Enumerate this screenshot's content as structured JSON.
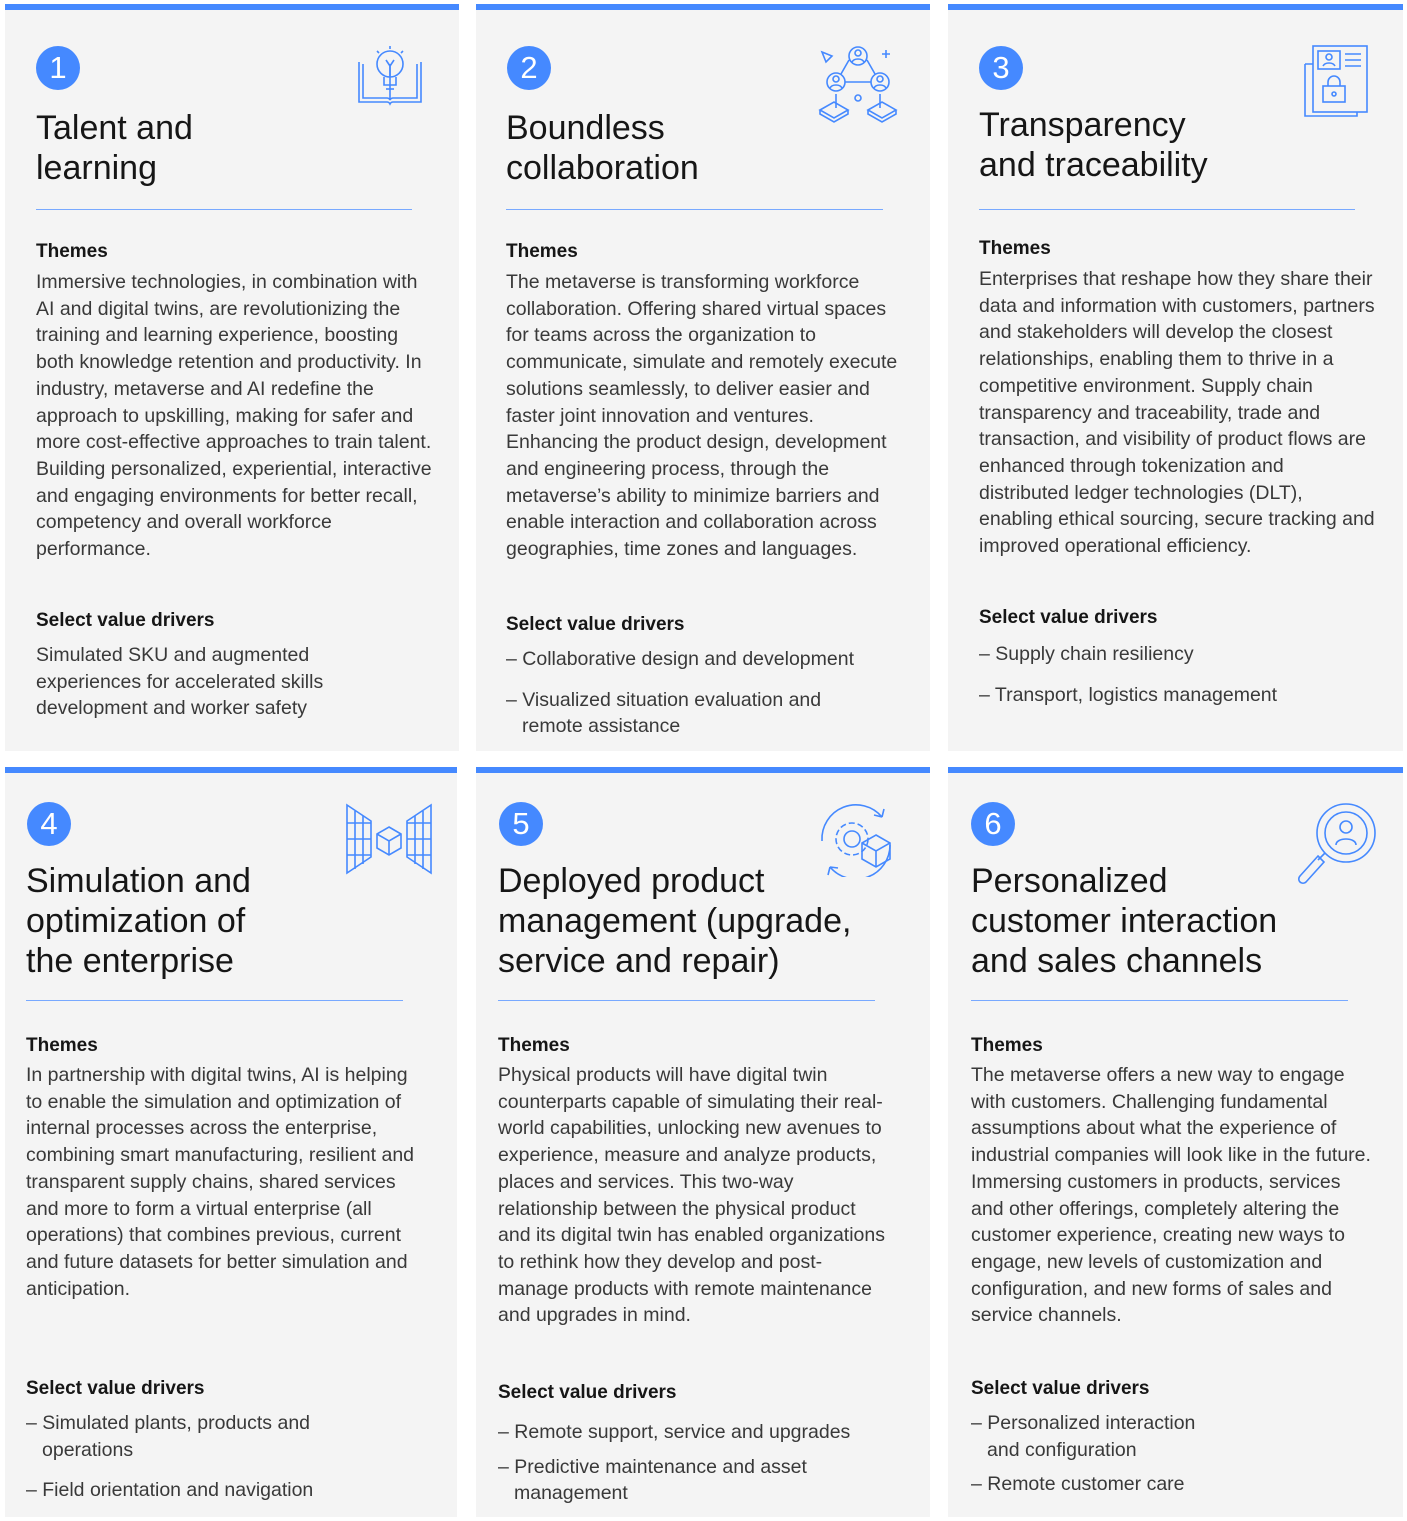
{
  "cards": [
    {
      "number": "1",
      "icon": "lightbulb-book-icon",
      "title": "Talent and\nlearning",
      "themes_label": "Themes",
      "themes_text": "Immersive technologies, in combination with AI and digital twins, are revolutionizing the training and learning experience, boosting both knowledge retention and productivity. In industry, metaverse and AI redefine the approach to upskilling, making for safer and more cost-effective approaches to train talent. Building personalized, experiential, interactive and engaging environments for better recall, competency and overall workforce performance.",
      "drivers_label": "Select value drivers",
      "drivers": [
        "Simulated SKU and augmented experiences for accelerated skills development and worker safety"
      ]
    },
    {
      "number": "2",
      "icon": "people-network-icon",
      "title": "Boundless\ncollaboration",
      "themes_label": "Themes",
      "themes_text": "The metaverse is transforming workforce collaboration. Offering shared virtual spaces for teams across the organization to communicate, simulate and remotely execute solutions seamlessly, to deliver easier and faster joint innovation and ventures. Enhancing the product design, development and engineering process, through the metaverse’s ability to minimize barriers and enable interaction and collaboration across geographies, time zones and languages.",
      "drivers_label": "Select value drivers",
      "drivers": [
        "– Collaborative design and development",
        "– Visualized situation evaluation and remote assistance"
      ]
    },
    {
      "number": "3",
      "icon": "secure-document-icon",
      "title": "Transparency\nand traceability",
      "themes_label": "Themes",
      "themes_text": "Enterprises that reshape how they share their data and information with customers, partners and stakeholders will develop the closest relationships, enabling them to thrive in a competitive environment. Supply chain transparency and traceability, trade and transaction, and visibility of product flows are enhanced through tokenization and distributed ledger technologies (DLT), enabling ethical sourcing, secure tracking and improved operational efficiency.",
      "drivers_label": "Select value drivers",
      "drivers": [
        "– Supply chain resiliency",
        "– Transport, logistics management"
      ]
    },
    {
      "number": "4",
      "icon": "mirrored-cube-icon",
      "title": "Simulation and\noptimization of\nthe enterprise",
      "themes_label": "Themes",
      "themes_text": "In partnership with digital twins, AI is helping to enable the simulation and optimization of internal processes across the enterprise, combining smart manufacturing, resilient and transparent supply chains, shared services and more to form a virtual enterprise (all operations) that combines previous, current and future datasets for better simulation and anticipation.",
      "drivers_label": "Select value drivers",
      "drivers": [
        "– Simulated plants, products and operations",
        "– Field orientation and navigation"
      ]
    },
    {
      "number": "5",
      "icon": "gear-cube-cycle-icon",
      "title": "Deployed product\nmanagement (upgrade,\nservice and repair)",
      "themes_label": "Themes",
      "themes_text": "Physical products will have digital twin counterparts capable of simulating their real-world capabilities, unlocking new avenues to experience, measure and analyze products, places and services. This two-way relationship between the physical product and its digital twin has enabled organizations to rethink how they develop and post-manage products with remote maintenance and upgrades in mind.",
      "drivers_label": "Select value drivers",
      "drivers": [
        "– Remote support, service and upgrades",
        "– Predictive maintenance and asset management"
      ]
    },
    {
      "number": "6",
      "icon": "magnifier-user-icon",
      "title": "Personalized\ncustomer interaction\nand sales channels",
      "themes_label": "Themes",
      "themes_text": "The metaverse offers a new way to engage with customers. Challenging fundamental assumptions about what the experience of industrial companies will look like in the future. Immersing customers in products, services and other offerings, completely altering the customer experience, creating new ways to engage, new levels of customization and configuration, and new forms of sales and service channels.",
      "drivers_label": "Select value drivers",
      "drivers": [
        "– Personalized interaction and configuration",
        "– Remote customer care"
      ]
    }
  ]
}
